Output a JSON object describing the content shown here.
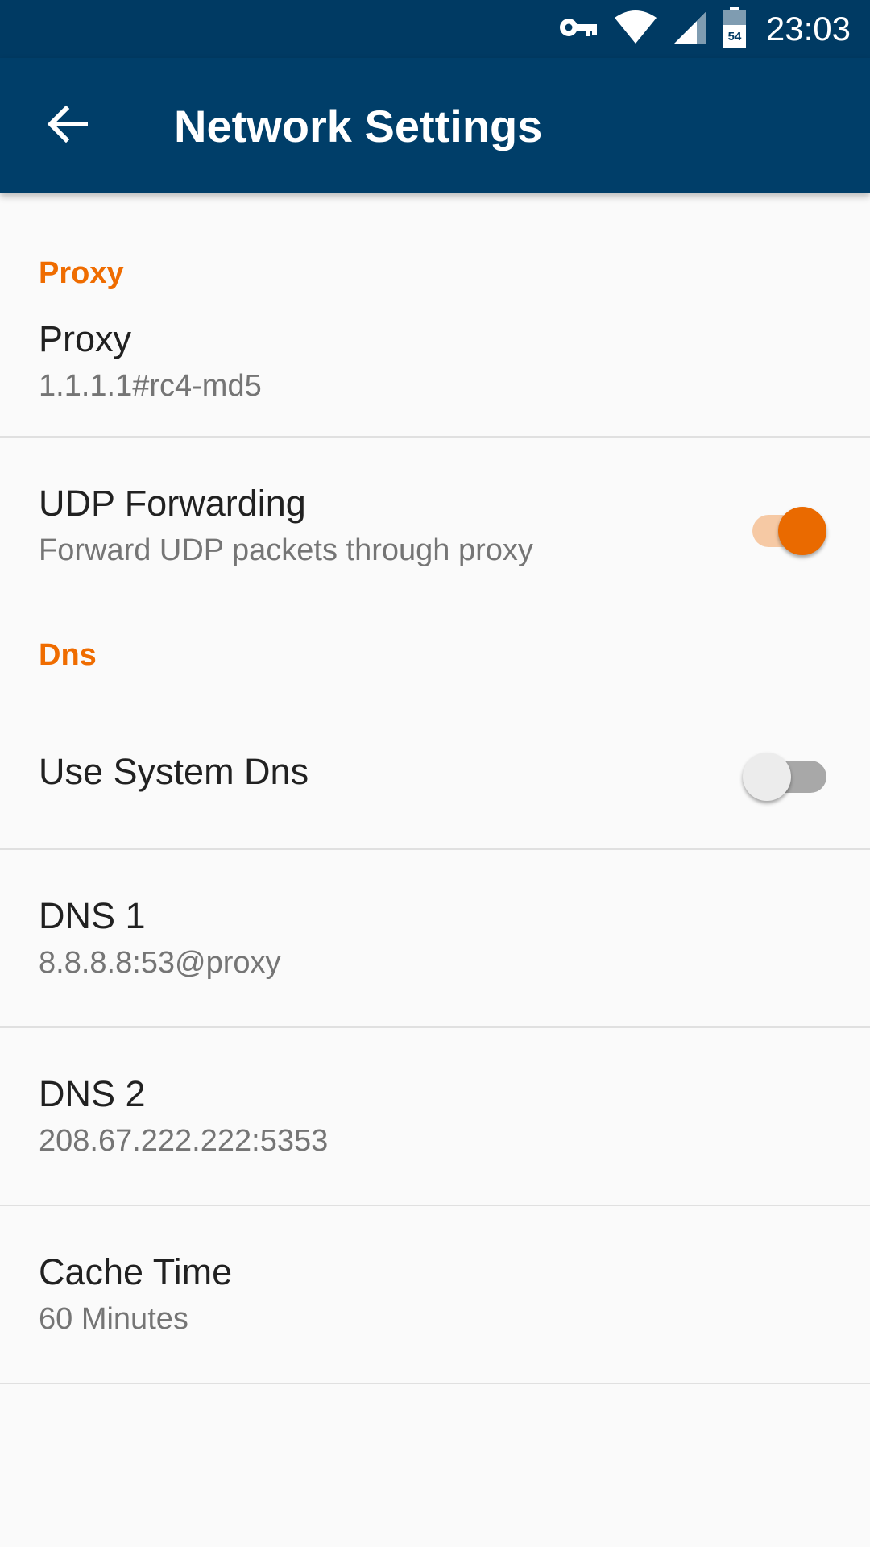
{
  "status_bar": {
    "time": "23:03",
    "battery_level": "54",
    "icons": [
      "vpn-key-icon",
      "wifi-icon",
      "cell-signal-icon",
      "battery-icon"
    ]
  },
  "app_bar": {
    "title": "Network Settings",
    "back_icon": "arrow-back-icon"
  },
  "sections": {
    "proxy": {
      "header": "Proxy",
      "proxy_item": {
        "title": "Proxy",
        "summary": "1.1.1.1#rc4-md5"
      },
      "udp_item": {
        "title": "UDP Forwarding",
        "summary": "Forward UDP packets through proxy",
        "enabled": true
      }
    },
    "dns": {
      "header": "Dns",
      "system_dns": {
        "title": "Use System Dns",
        "enabled": false
      },
      "dns1": {
        "title": "DNS 1",
        "summary": "8.8.8.8:53@proxy"
      },
      "dns2": {
        "title": "DNS 2",
        "summary": "208.67.222.222:5353"
      },
      "cache_time": {
        "title": "Cache Time",
        "summary": "60 Minutes"
      }
    }
  },
  "colors": {
    "status_bar": "#003a63",
    "app_bar": "#003e69",
    "accent": "#ef6c00",
    "switch_on_thumb": "#ea6a00",
    "switch_on_track": "#f6c9a4"
  }
}
